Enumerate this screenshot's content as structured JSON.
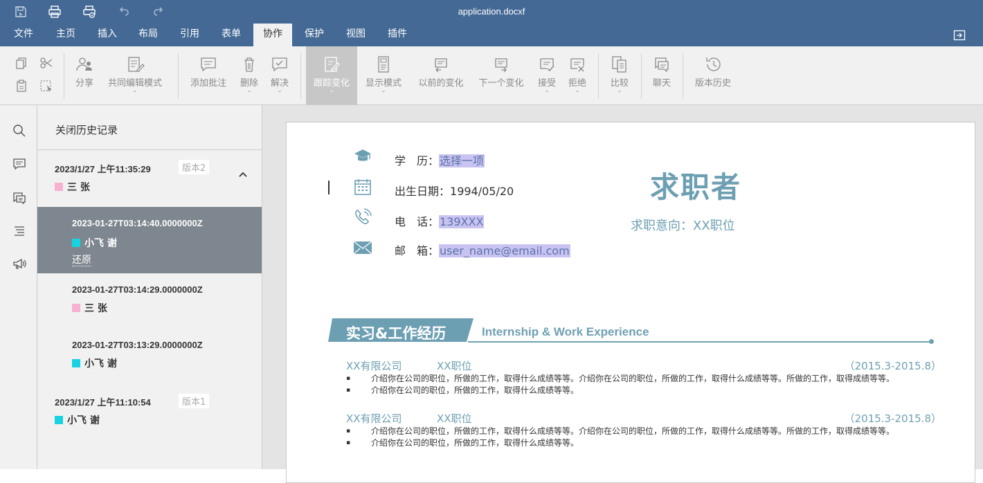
{
  "window": {
    "title": "application.docxf"
  },
  "quick_access": [
    {
      "name": "save-icon"
    },
    {
      "name": "print-icon"
    },
    {
      "name": "quick-print-icon"
    },
    {
      "name": "undo-icon"
    },
    {
      "name": "redo-icon"
    }
  ],
  "menu": {
    "tabs": [
      "文件",
      "主页",
      "插入",
      "布局",
      "引用",
      "表单",
      "协作",
      "保护",
      "视图",
      "插件"
    ],
    "active": "协作"
  },
  "toolbar": {
    "share": "分享",
    "coedit": "共同编辑模式",
    "add_comment": "添加批注",
    "delete": "删除",
    "resolve": "解决",
    "track_changes": "跟踪变化",
    "display_mode": "显示模式",
    "prev_change": "以前的变化",
    "next_change": "下一个变化",
    "accept": "接受",
    "reject": "拒绝",
    "compare": "比较",
    "chat": "聊天",
    "version_history": "版本历史"
  },
  "history": {
    "close_label": "关闭历史记录",
    "versions": [
      {
        "date": "2023/1/27 上午11:35:29",
        "badge": "版本2",
        "user": "三 张",
        "color": "#f5b1cf"
      },
      {
        "date": "2023-01-27T03:14:40.0000000Z",
        "user": "小飞 谢",
        "color": "#15d3e0",
        "restore": "还原"
      },
      {
        "date": "2023-01-27T03:14:29.0000000Z",
        "user": "三 张",
        "color": "#f5b1cf"
      },
      {
        "date": "2023-01-27T03:13:29.0000000Z",
        "user": "小飞 谢",
        "color": "#15d3e0"
      },
      {
        "date": "2023/1/27 上午11:10:54",
        "badge": "版本1",
        "user": "小飞 谢",
        "color": "#15d3e0"
      }
    ]
  },
  "document": {
    "education_label": "学　历：",
    "education_value": "选择一项",
    "birth_label": "出生日期：",
    "birth_value": "1994/05/20",
    "phone_label": "电　话：",
    "phone_value": "139XXX",
    "email_label": "邮　箱：",
    "email_value": "user_name@email.com",
    "title": "求职者",
    "intent": "求职意向：XX职位",
    "section_cn": "实习&工作经历",
    "section_en": "Internship & Work Experience",
    "jobs": [
      {
        "company": "XX有限公司",
        "position": "XX职位",
        "period": "（2015.3-2015.8）",
        "bullets": [
          "介绍你在公司的职位，所做的工作，取得什么成绩等等。介绍你在公司的职位，所做的工作，取得什么成绩等等。所做的工作，取得成绩等等。",
          "介绍你在公司的职位，所做的工作，取得什么成绩等等。"
        ]
      },
      {
        "company": "XX有限公司",
        "position": "XX职位",
        "period": "（2015.3-2015.8）",
        "bullets": [
          "介绍你在公司的职位，所做的工作，取得什么成绩等等。介绍你在公司的职位，所做的工作，取得什么成绩等等。所做的工作，取得成绩等等。",
          "介绍你在公司的职位，所做的工作，取得什么成绩等等。"
        ]
      }
    ]
  },
  "colors": {
    "header": "#446995",
    "accent": "#6d9fb3",
    "highlight": "#c9c3f2",
    "selected_row": "#7e878f"
  }
}
